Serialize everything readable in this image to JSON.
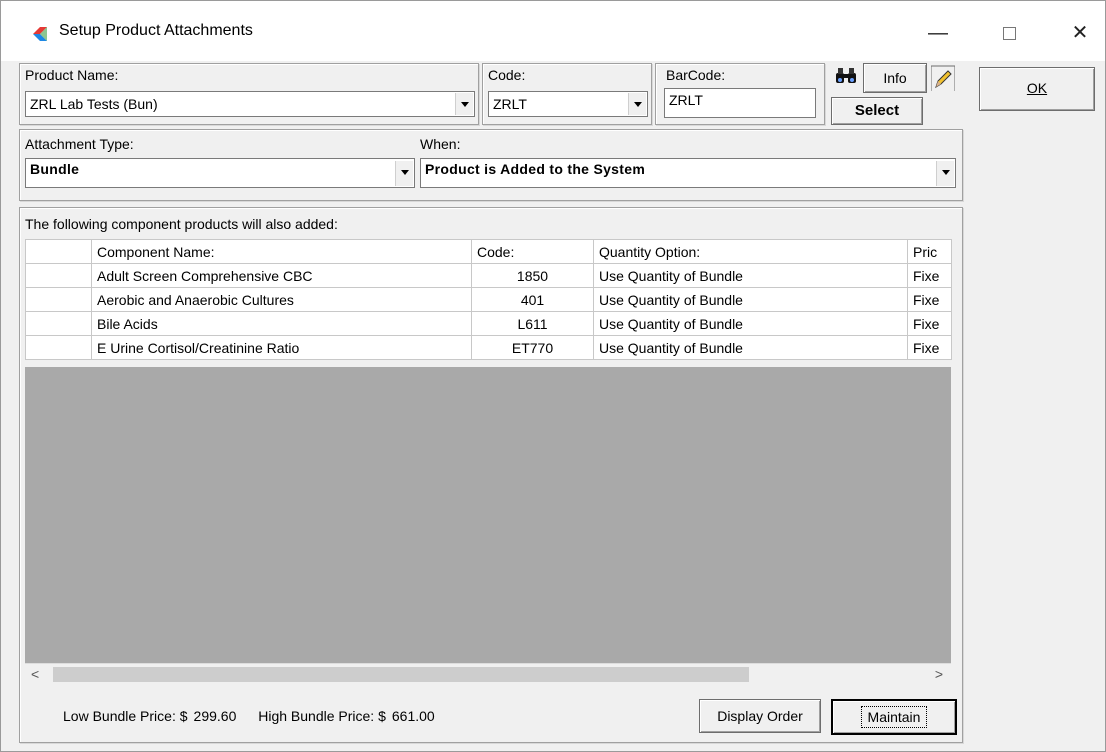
{
  "window": {
    "title": "Setup Product Attachments",
    "minimize": "—",
    "close": "✕"
  },
  "product": {
    "name_label": "Product Name:",
    "name_value": "ZRL Lab Tests (Bun)",
    "code_label": "Code:",
    "code_value": "ZRLT",
    "barcode_label": "BarCode:",
    "barcode_value": "ZRLT",
    "info_label": "Info",
    "select_label": "Select"
  },
  "ok_button": "OK",
  "attachment": {
    "type_label": "Attachment Type:",
    "type_value": "Bundle",
    "when_label": "When:",
    "when_value": "Product is Added to the System"
  },
  "grid": {
    "caption": "The following component products will also added:",
    "columns": [
      "",
      "Component Name:",
      "Code:",
      "Quantity Option:",
      "Pric"
    ],
    "rows": [
      {
        "name": "Adult Screen Comprehensive CBC",
        "code": "1850",
        "qty": "Use Quantity of Bundle",
        "price": "Fixe"
      },
      {
        "name": "Aerobic and Anaerobic Cultures",
        "code": "401",
        "qty": "Use Quantity of Bundle",
        "price": "Fixe"
      },
      {
        "name": "Bile Acids",
        "code": "L611",
        "qty": "Use Quantity of Bundle",
        "price": "Fixe"
      },
      {
        "name": "E Urine Cortisol/Creatinine Ratio",
        "code": "ET770",
        "qty": "Use Quantity of Bundle",
        "price": "Fixe"
      }
    ]
  },
  "footer": {
    "low_label": "Low Bundle Price: $",
    "low_value": "299.60",
    "high_label": "High Bundle Price: $",
    "high_value": "661.00",
    "display_order": "Display Order",
    "maintain": "Maintain"
  }
}
